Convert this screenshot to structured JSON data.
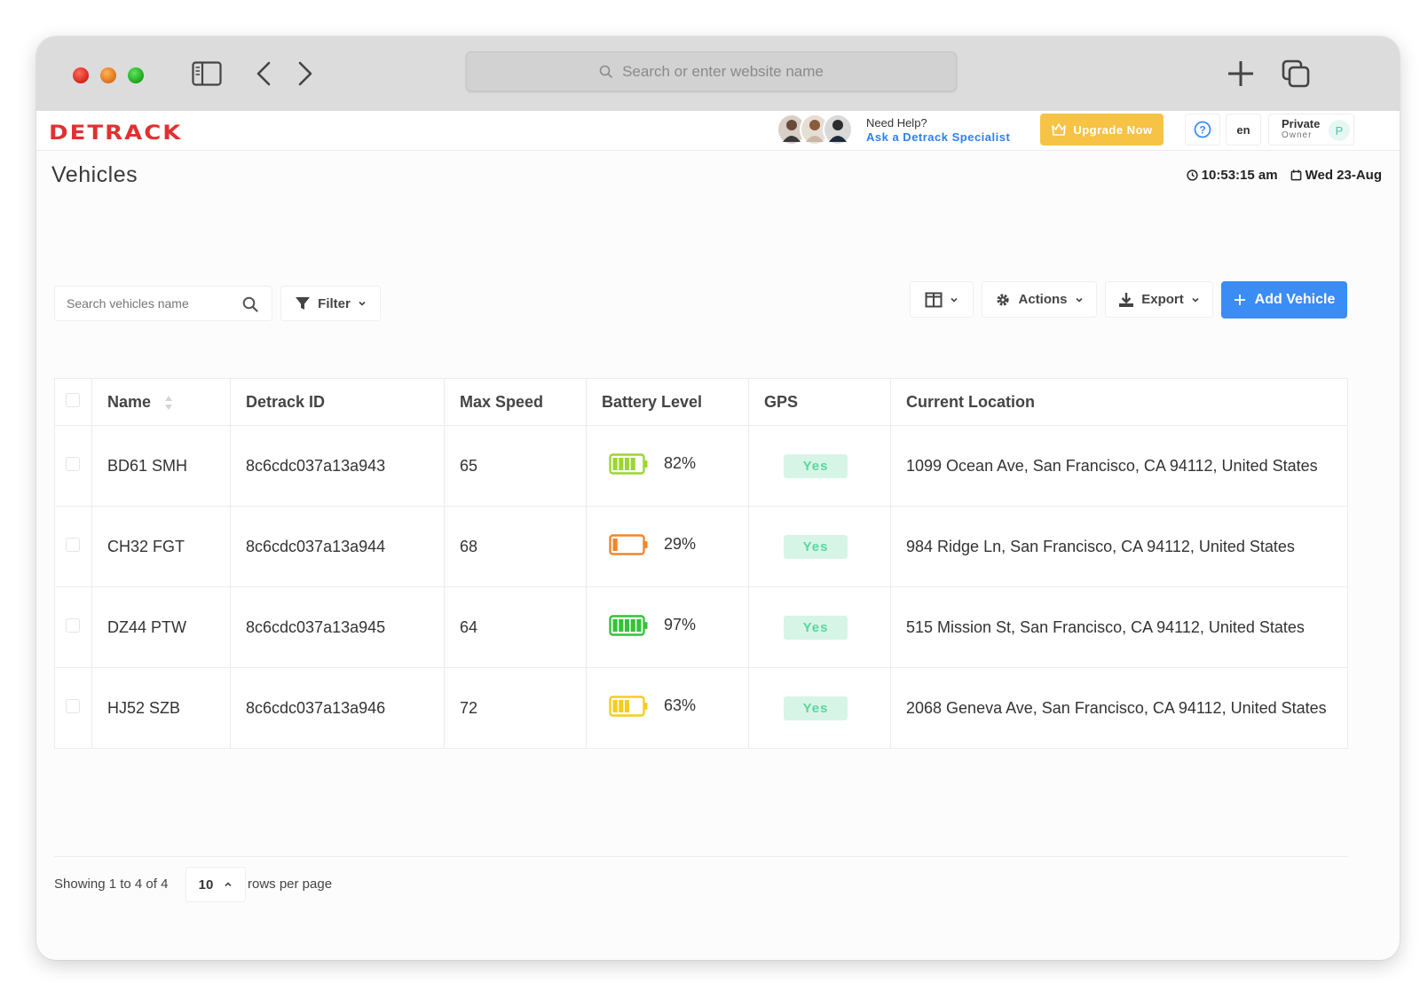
{
  "browser": {
    "url_placeholder": "Search or enter website name"
  },
  "header": {
    "logo_text": "DETRACK",
    "help_line1": "Need Help?",
    "help_line2": "Ask a Detrack Specialist",
    "upgrade_label": "Upgrade Now",
    "language": "en",
    "user_name": "Private",
    "user_role": "Owner",
    "user_initial": "P"
  },
  "page": {
    "title": "Vehicles",
    "time": "10:53:15 am",
    "date": "Wed 23-Aug"
  },
  "toolbar": {
    "search_placeholder": "Search vehicles name",
    "filter_label": "Filter",
    "actions_label": "Actions",
    "export_label": "Export",
    "add_label": "Add Vehicle"
  },
  "table": {
    "columns": [
      "Name",
      "Detrack ID",
      "Max Speed",
      "Battery Level",
      "GPS",
      "Current Location"
    ],
    "rows": [
      {
        "name": "BD61 SMH",
        "id": "8c6cdc037a13a943",
        "max_speed": "65",
        "battery": "82%",
        "battery_level": 0.82,
        "battery_color": "#9bd62f",
        "gps": "Yes",
        "location": "1099 Ocean Ave, San Francisco, CA 94112, United States"
      },
      {
        "name": "CH32 FGT",
        "id": "8c6cdc037a13a944",
        "max_speed": "68",
        "battery": "29%",
        "battery_level": 0.29,
        "battery_color": "#f0862c",
        "gps": "Yes",
        "location": "984 Ridge Ln, San Francisco, CA 94112, United States"
      },
      {
        "name": "DZ44 PTW",
        "id": "8c6cdc037a13a945",
        "max_speed": "64",
        "battery": "97%",
        "battery_level": 0.97,
        "battery_color": "#35c23a",
        "gps": "Yes",
        "location": "515 Mission St, San Francisco, CA 94112, United States"
      },
      {
        "name": "HJ52 SZB",
        "id": "8c6cdc037a13a946",
        "max_speed": "72",
        "battery": "63%",
        "battery_level": 0.63,
        "battery_color": "#f5cc1f",
        "gps": "Yes",
        "location": "2068 Geneva Ave, San Francisco, CA 94112, United States"
      }
    ]
  },
  "footer": {
    "showing": "Showing 1 to 4 of 4",
    "rows_value": "10",
    "rows_label": "rows per page"
  },
  "colors": {
    "brand": "#e03131",
    "primary": "#3b8cf5",
    "upgrade": "#f6c345",
    "gps_badge_bg": "#d7f5e7",
    "gps_badge_text": "#5cd69c"
  }
}
